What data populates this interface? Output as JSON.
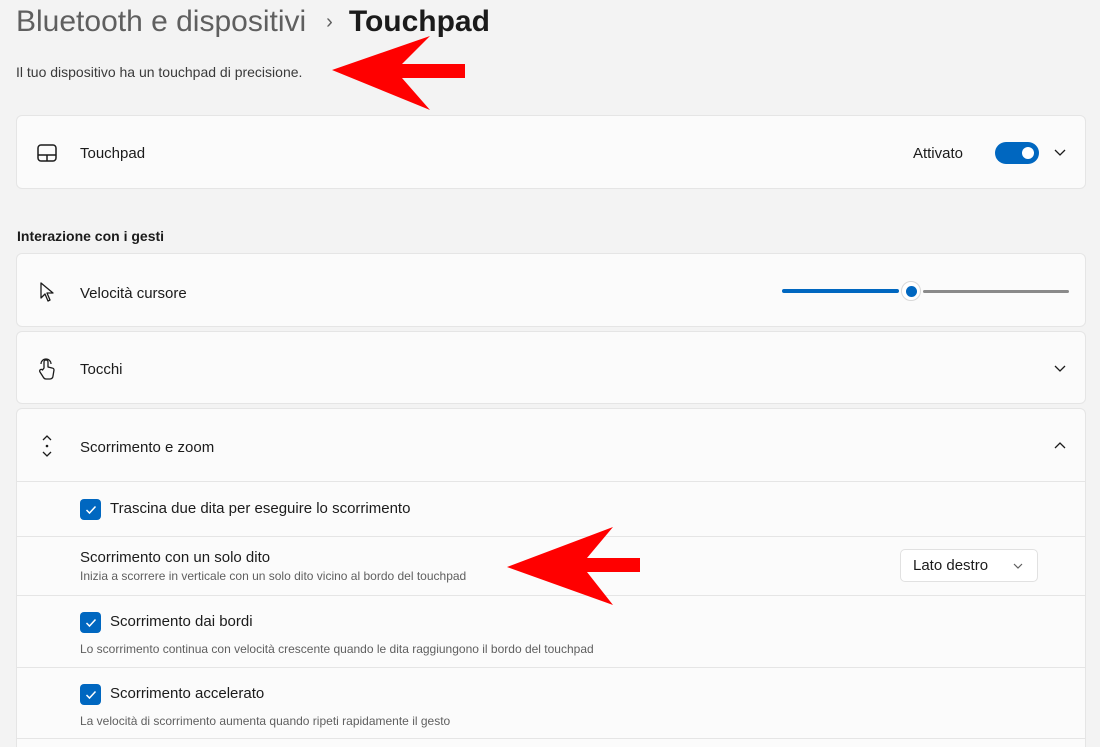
{
  "breadcrumb": {
    "parent": "Bluetooth e dispositivi",
    "separator": "›",
    "current": "Touchpad"
  },
  "subtitle": "Il tuo dispositivo ha un touchpad di precisione.",
  "touchpad_card": {
    "icon": "touchpad-icon",
    "label": "Touchpad",
    "toggle_state": "Attivato",
    "toggle_on": true
  },
  "gestures_section": {
    "title": "Interazione con i gesti",
    "cursor_speed": {
      "icon": "cursor-icon",
      "label": "Velocità cursore",
      "slider_value_fraction": 0.45
    },
    "taps": {
      "icon": "tap-icon",
      "label": "Tocchi"
    },
    "scroll_zoom": {
      "icon": "scroll-icon",
      "label": "Scorrimento e zoom",
      "expanded": true,
      "options": {
        "two_finger": {
          "label": "Trascina due dita per eseguire lo scorrimento",
          "checked": true
        },
        "one_finger": {
          "title": "Scorrimento con un solo dito",
          "description": "Inizia a scorrere in verticale con un solo dito vicino al bordo del touchpad",
          "dropdown_value": "Lato destro"
        },
        "edge_scroll": {
          "label": "Scorrimento dai bordi",
          "description": "Lo scorrimento continua con velocità crescente quando le dita raggiungono il bordo del touchpad",
          "checked": true
        },
        "accelerated": {
          "label": "Scorrimento accelerato",
          "description": "La velocità di scorrimento aumenta quando ripeti rapidamente il gesto",
          "checked": true
        }
      }
    }
  },
  "colors": {
    "accent": "#0067c0",
    "annotation_arrow": "#ff0000",
    "background": "#f3f3f3",
    "card": "#fbfbfb"
  }
}
